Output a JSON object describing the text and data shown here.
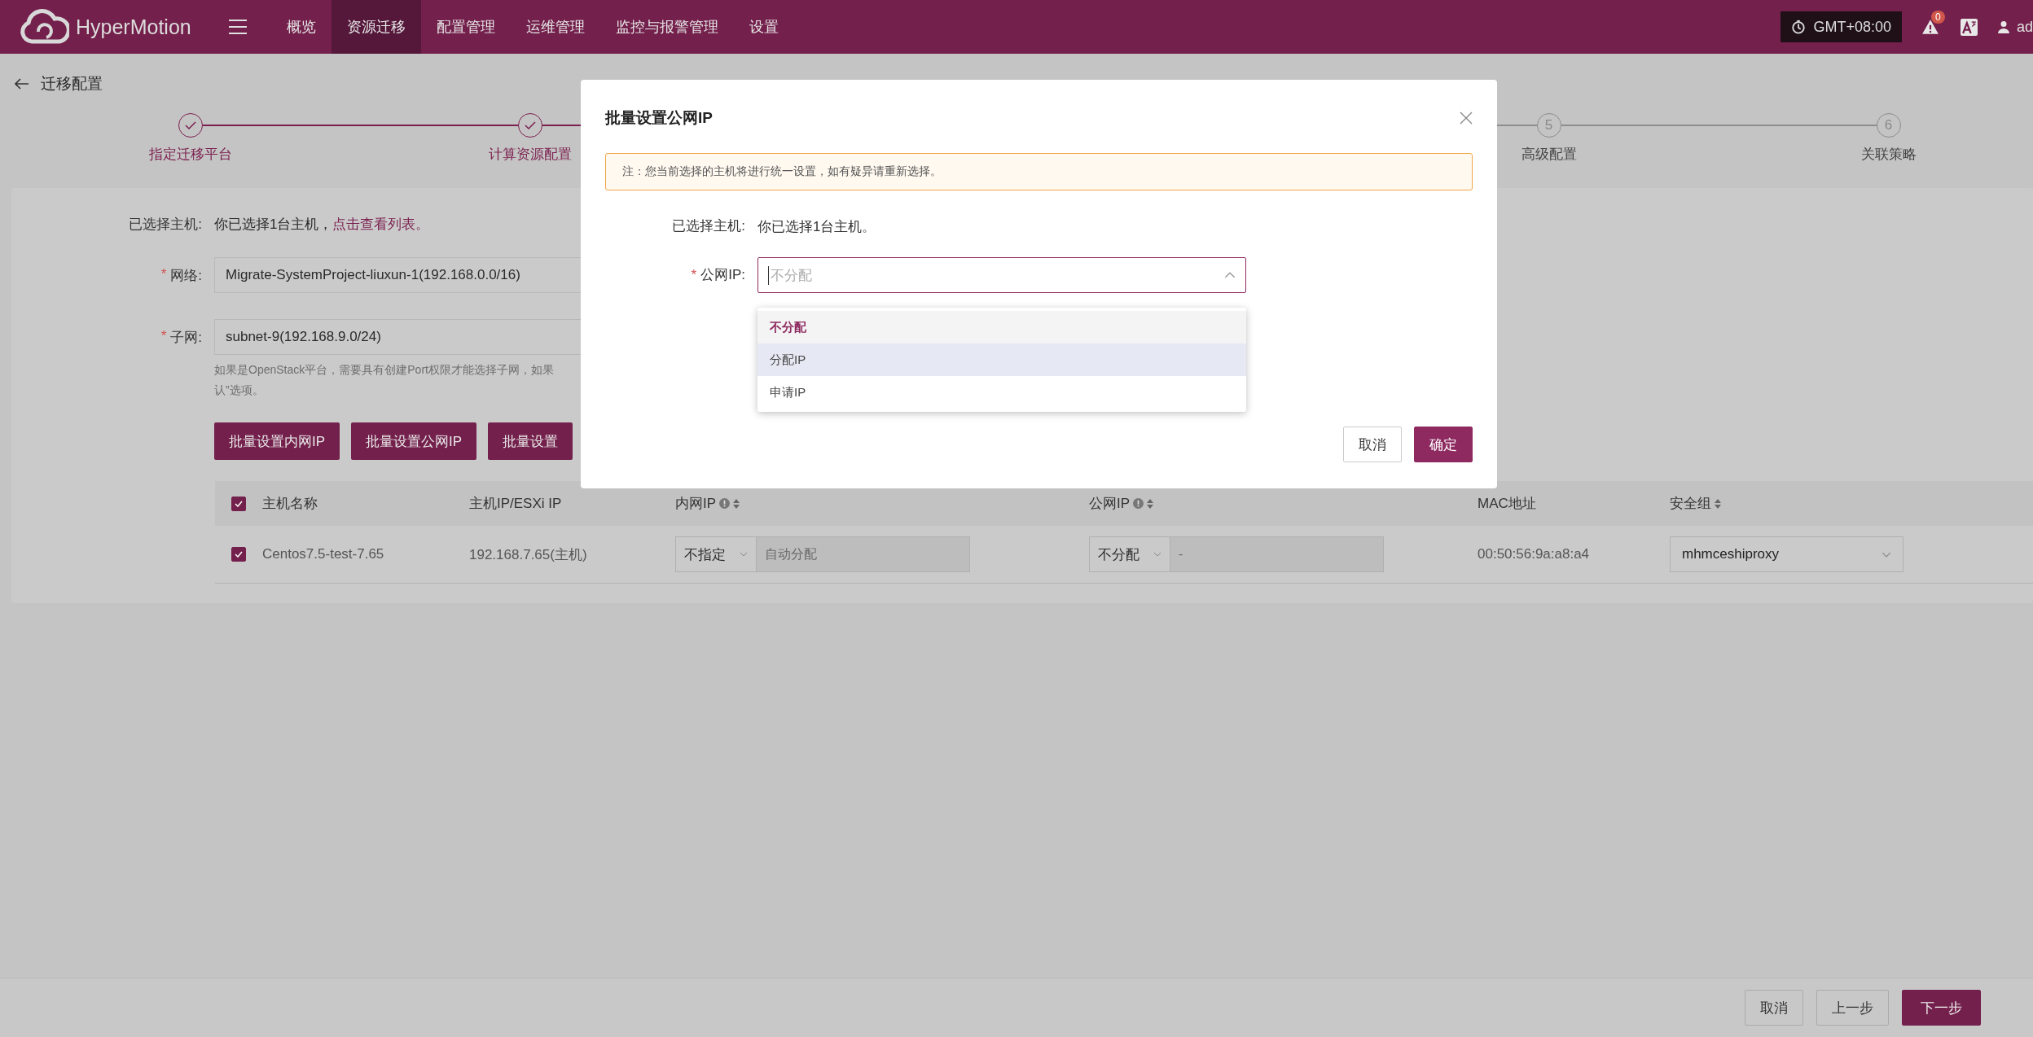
{
  "topbar": {
    "brand": "HyperMotion",
    "nav": [
      {
        "label": "概览",
        "selected": false
      },
      {
        "label": "资源迁移",
        "selected": true
      },
      {
        "label": "配置管理",
        "selected": false
      },
      {
        "label": "运维管理",
        "selected": false
      },
      {
        "label": "监控与报警管理",
        "selected": false
      },
      {
        "label": "设置",
        "selected": false
      }
    ],
    "timezone": "GMT+08:00",
    "alert_count": "0",
    "user": "ad"
  },
  "page": {
    "title": "迁移配置"
  },
  "steps": [
    {
      "label": "指定迁移平台",
      "done": true
    },
    {
      "label": "计算资源配置",
      "done": true
    },
    {
      "number": "5",
      "label": "高级配置",
      "done": false
    },
    {
      "number": "6",
      "label": "关联策略",
      "done": false
    }
  ],
  "form": {
    "selected_hosts": {
      "label": "已选择主机:",
      "text": "你已选择1台主机，",
      "link": "点击查看列表。"
    },
    "network": {
      "label": "网络:",
      "required_mark": "*",
      "value": "Migrate-SystemProject-liuxun-1(192.168.0.0/16)"
    },
    "subnet": {
      "label": "子网:",
      "required_mark": "*",
      "value": "subnet-9(192.168.9.0/24)",
      "hint_lines": [
        "如果是OpenStack平台，需要具有创建Port权限才能选择子网，如果",
        "认”选项。"
      ]
    },
    "batch_buttons": [
      "批量设置内网IP",
      "批量设置公网IP",
      "批量设置"
    ]
  },
  "table": {
    "all_checked": true,
    "columns": [
      {
        "label": "主机名称",
        "info": false,
        "sortable": false
      },
      {
        "label": "主机IP/ESXi IP",
        "info": false,
        "sortable": false
      },
      {
        "label": "内网IP",
        "info": true,
        "sortable": true
      },
      {
        "label": "公网IP",
        "info": true,
        "sortable": true
      },
      {
        "label": "MAC地址",
        "info": false,
        "sortable": false
      },
      {
        "label": "安全组",
        "info": false,
        "sortable": true
      }
    ],
    "rows": [
      {
        "checked": true,
        "name": "Centos7.5-test-7.65",
        "ip": "192.168.7.65(主机)",
        "private_ip": {
          "mode": "不指定",
          "placeholder": "自动分配"
        },
        "public_ip": {
          "mode": "不分配",
          "placeholder": "-"
        },
        "mac": "00:50:56:9a:a8:a4",
        "security_group": "mhmceshiproxy"
      }
    ]
  },
  "footer": {
    "buttons": [
      {
        "label": "取消",
        "kind": "default"
      },
      {
        "label": "上一步",
        "kind": "default"
      },
      {
        "label": "下一步",
        "kind": "primary"
      }
    ]
  },
  "modal": {
    "title": "批量设置公网IP",
    "notice": "注：您当前选择的主机将进行统一设置，如有疑异请重新选择。",
    "selected_label": "已选择主机:",
    "selected_text": "你已选择1台主机。",
    "field": {
      "label": "公网IP:",
      "required_mark": "*",
      "placeholder": "不分配",
      "expanded": true
    },
    "options": [
      {
        "label": "不分配",
        "selected": true,
        "hovered": false
      },
      {
        "label": "分配IP",
        "selected": false,
        "hovered": true
      },
      {
        "label": "申请IP",
        "selected": false,
        "hovered": false
      }
    ],
    "buttons": [
      {
        "label": "取消",
        "kind": "default"
      },
      {
        "label": "确定",
        "kind": "primary"
      }
    ]
  }
}
